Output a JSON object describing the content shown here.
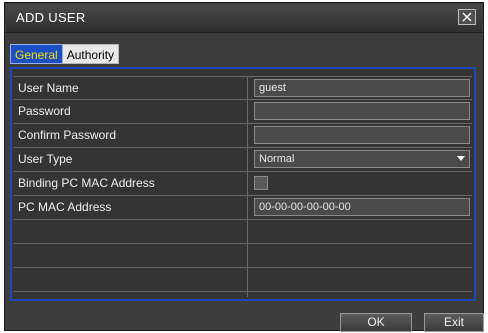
{
  "dialog": {
    "title": "ADD USER",
    "close_label": "X"
  },
  "tabs": [
    {
      "label": "General",
      "active": true
    },
    {
      "label": "Authority",
      "active": false
    }
  ],
  "fields": {
    "user_name": {
      "label": "User Name",
      "value": "guest"
    },
    "password": {
      "label": "Password",
      "value": ""
    },
    "confirm_password": {
      "label": "Confirm Password",
      "value": ""
    },
    "user_type": {
      "label": "User Type",
      "value": "Normal"
    },
    "binding_mac": {
      "label": "Binding PC MAC Address",
      "checked": false
    },
    "pc_mac": {
      "label": "PC MAC Address",
      "value": "00-00-00-00-00-00"
    }
  },
  "buttons": {
    "ok": "OK",
    "exit": "Exit"
  },
  "colors": {
    "accent": "#1d49b8",
    "active_tab_text": "#f5e000"
  }
}
